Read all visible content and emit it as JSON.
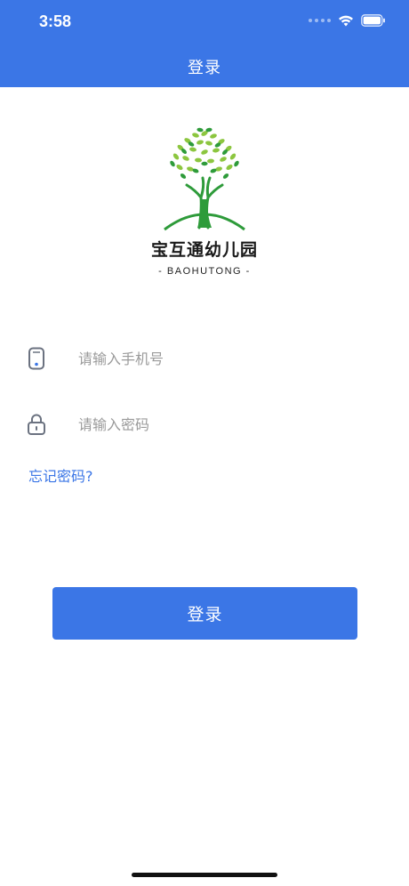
{
  "status_bar": {
    "time": "3:58"
  },
  "nav": {
    "title": "登录"
  },
  "logo": {
    "name": "宝互通幼儿园",
    "subtitle": "- BAOHUTONG -"
  },
  "phone_field": {
    "placeholder": "请输入手机号",
    "value": ""
  },
  "password_field": {
    "placeholder": "请输入密码",
    "value": ""
  },
  "forgot_password": {
    "label": "忘记密码?"
  },
  "login_button": {
    "label": "登录"
  },
  "icons": {
    "phone": "phone-icon",
    "lock": "lock-icon",
    "wifi": "wifi-icon",
    "battery": "battery-icon",
    "logo": "tree-logo-icon"
  },
  "colors": {
    "primary": "#3b76e6",
    "leaf_light": "#8cc63f",
    "leaf_dark": "#2e9b3a",
    "input_icon": "#6b7280",
    "placeholder": "#9a9a9a"
  }
}
